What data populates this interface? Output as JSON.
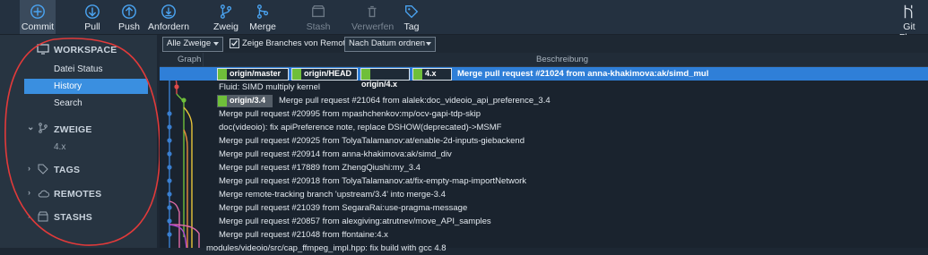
{
  "toolbar": {
    "buttons": [
      {
        "label": "Commit",
        "icon": "plus-circle-icon"
      },
      {
        "label": "Pull",
        "icon": "arrow-down-circle-icon"
      },
      {
        "label": "Push",
        "icon": "arrow-up-circle-icon"
      },
      {
        "label": "Anfordern",
        "icon": "download-circle-icon"
      },
      {
        "label": "Zweig",
        "icon": "branch-icon"
      },
      {
        "label": "Merge",
        "icon": "merge-icon"
      },
      {
        "label": "Stash",
        "icon": "stash-icon",
        "disabled": true
      },
      {
        "label": "Verwerfen",
        "icon": "discard-icon",
        "disabled": true
      },
      {
        "label": "Tag",
        "icon": "tag-icon"
      },
      {
        "label": "Git Flow",
        "icon": "git-flow-icon"
      }
    ]
  },
  "sidebar": {
    "workspace": {
      "label": "WORKSPACE",
      "icon": "monitor-icon"
    },
    "workspace_items": [
      {
        "label": "Datei Status"
      },
      {
        "label": "History",
        "active": true
      },
      {
        "label": "Search"
      }
    ],
    "branches": {
      "label": "ZWEIGE",
      "icon": "branch-icon",
      "items": [
        "4.x"
      ]
    },
    "tags": {
      "label": "TAGS",
      "icon": "tag-icon"
    },
    "remotes": {
      "label": "REMOTES",
      "icon": "cloud-icon"
    },
    "stashes": {
      "label": "STASHS",
      "icon": "stash-box-icon"
    }
  },
  "filterbar": {
    "branches_select": "Alle Zweige",
    "show_remote_label": "Zeige Branches von Remote",
    "show_remote_checked": true,
    "order_select": "Nach Datum ordnen"
  },
  "columns": {
    "graph": "Graph",
    "description": "Beschreibung"
  },
  "commits": [
    {
      "refs": [
        "origin/master",
        "origin/HEAD",
        "origin/4.x",
        "4.x"
      ],
      "message": "Merge pull request #21024 from anna-khakimova:ak/simd_mul",
      "selected": true
    },
    {
      "refs": [],
      "message": "Fluid: SIMD multiply kernel"
    },
    {
      "refs": [
        "origin/3.4"
      ],
      "message": "Merge pull request #21064 from alalek:doc_videoio_api_preference_3.4"
    },
    {
      "refs": [],
      "message": "Merge pull request #20995 from mpashchenkov:mp/ocv-gapi-tdp-skip"
    },
    {
      "refs": [],
      "message": "doc(videoio): fix apiPreference note, replace DSHOW(deprecated)->MSMF"
    },
    {
      "refs": [],
      "message": "Merge pull request #20925 from TolyaTalamanov:at/enable-2d-inputs-giebackend"
    },
    {
      "refs": [],
      "message": "Merge pull request #20914 from anna-khakimova:ak/simd_div"
    },
    {
      "refs": [],
      "message": "Merge pull request #17889 from ZhengQiushi:my_3.4"
    },
    {
      "refs": [],
      "message": "Merge pull request #20918 from TolyaTalamanov:at/fix-empty-map-importNetwork"
    },
    {
      "refs": [],
      "message": "Merge remote-tracking branch 'upstream/3.4' into merge-3.4"
    },
    {
      "refs": [],
      "message": "Merge pull request #21039 from SegaraRai:use-pragma-message"
    },
    {
      "refs": [],
      "message": "Merge pull request #20857 from alexgiving:atrutnev/move_API_samples"
    },
    {
      "refs": [],
      "message": "Merge pull request #21048 from ffontaine:4.x"
    },
    {
      "refs": [],
      "message": "modules/videoio/src/cap_ffmpeg_impl.hpp: fix build with gcc 4.8"
    }
  ],
  "colors": {
    "accent": "#2f7fd8",
    "active_sidebar": "#3a8fe0",
    "annotation": "#e23a3a",
    "branch_blue": "#3a7fd0",
    "branch_green": "#6fbf3a",
    "branch_yellow": "#e8c43a",
    "branch_orange": "#e88a3a",
    "branch_pink": "#e06aa8",
    "branch_red": "#e04a4a"
  }
}
